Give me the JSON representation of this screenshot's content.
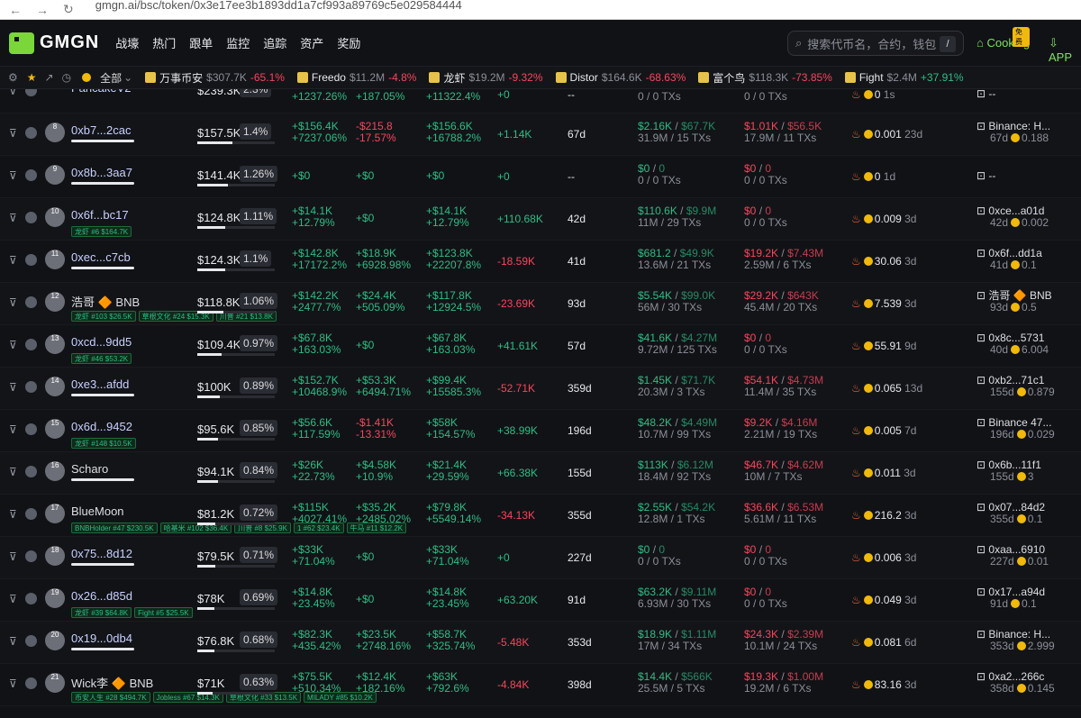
{
  "browser": {
    "url": "gmgn.ai/bsc/token/0x3e17ee3b1893dd1a7cf993a89769c5e029584444"
  },
  "header": {
    "logo": "GMGN",
    "menu": [
      "战壕",
      "热门",
      "跟单",
      "监控",
      "追踪",
      "资产",
      "奖励"
    ],
    "search_placeholder": "搜索代币名，合约，钱包",
    "search_key": "/",
    "cooking": "Cooking",
    "cooking_badge": "免费",
    "app": "APP"
  },
  "ticker": {
    "filter_label": "全部",
    "items": [
      {
        "name": "万事币安",
        "mc": "$307.7K",
        "change": "-65.1%",
        "dir": "neg"
      },
      {
        "name": "Freedo",
        "mc": "$11.2M",
        "change": "-4.8%",
        "dir": "neg"
      },
      {
        "name": "龙虾",
        "mc": "$19.2M",
        "change": "-9.32%",
        "dir": "neg"
      },
      {
        "name": "Distor",
        "mc": "$164.6K",
        "change": "-68.63%",
        "dir": "neg"
      },
      {
        "name": "富个鸟",
        "mc": "$118.3K",
        "change": "-73.85%",
        "dir": "neg"
      },
      {
        "name": "Fight",
        "mc": "$2.4M",
        "change": "+37.91%",
        "dir": "pos"
      }
    ]
  },
  "partial_row": {
    "addr": "PancakeV2",
    "bal": "$239.3K",
    "pct": "2.3%",
    "v1b": "+1237.26%",
    "v2b": "+187.05%",
    "v3b": "+11322.4%",
    "v4": "+0",
    "age": "--",
    "buyb": "0 / 0 TXs",
    "sellb": "0 / 0 TXs",
    "hold": "0",
    "hold_age": "1s",
    "src": "--"
  },
  "rows": [
    {
      "rank": "8",
      "addr": "0xb7...2cac",
      "bal": "$157.5K",
      "pct": "1.4%",
      "fill": 0.45,
      "v1a": "+$156.4K",
      "v1b": "+7237.06%",
      "v1c": "pos",
      "v2a": "-$215.8",
      "v2b": "-17.57%",
      "v2c": "neg",
      "v3a": "+$156.6K",
      "v3b": "+16788.2%",
      "v3c": "pos",
      "v4": "+1.14K",
      "v4c": "pos",
      "age": "67d",
      "buya": "$2.16K",
      "buyb": "$67.7K",
      "buyc": "31.9M / 15 TXs",
      "sella": "$1.01K",
      "sellb": "$56.5K",
      "sellc": "17.9M / 11 TXs",
      "hold": "0.001",
      "hold_age": "23d",
      "srca": "Binance: H...",
      "srcb": "67d",
      "srcc": "0.188",
      "badges": []
    },
    {
      "rank": "9",
      "addr": "0x8b...3aa7",
      "bal": "$141.4K",
      "pct": "1.26%",
      "fill": 0.4,
      "v1a": "+$0",
      "v1b": "",
      "v1c": "pos",
      "v2a": "+$0",
      "v2b": "",
      "v2c": "pos",
      "v3a": "+$0",
      "v3b": "",
      "v3c": "pos",
      "v4": "+0",
      "v4c": "pos",
      "age": "--",
      "buya": "$0",
      "buyb": "0",
      "buyc": "0 / 0 TXs",
      "sella": "$0",
      "sellb": "0",
      "sellc": "0 / 0 TXs",
      "hold": "0",
      "hold_age": "1d",
      "srca": "--",
      "srcb": "",
      "srcc": "",
      "badges": []
    },
    {
      "rank": "10",
      "addr": "0x6f...bc17",
      "bal": "$124.8K",
      "pct": "1.11%",
      "fill": 0.36,
      "v1a": "+$14.1K",
      "v1b": "+12.79%",
      "v1c": "pos",
      "v2a": "+$0",
      "v2b": "",
      "v2c": "pos",
      "v3a": "+$14.1K",
      "v3b": "+12.79%",
      "v3c": "pos",
      "v4": "+110.68K",
      "v4c": "pos",
      "age": "42d",
      "buya": "$110.6K",
      "buyb": "$9.9M",
      "buyc": "11M / 29 TXs",
      "sella": "$0",
      "sellb": "0",
      "sellc": "0 / 0 TXs",
      "hold": "0.009",
      "hold_age": "3d",
      "srca": "0xce...a01d",
      "srcb": "42d",
      "srcc": "0.002",
      "badges": [
        "龙虾 #6 $164.7K"
      ]
    },
    {
      "rank": "11",
      "addr": "0xec...c7cb",
      "bal": "$124.3K",
      "pct": "1.1%",
      "fill": 0.36,
      "v1a": "+$142.8K",
      "v1b": "+17172.2%",
      "v1c": "pos",
      "v2a": "+$18.9K",
      "v2b": "+6928.98%",
      "v2c": "pos",
      "v3a": "+$123.8K",
      "v3b": "+22207.8%",
      "v3c": "pos",
      "v4": "-18.59K",
      "v4c": "neg",
      "age": "41d",
      "buya": "$681.2",
      "buyb": "$49.9K",
      "buyc": "13.6M / 21 TXs",
      "sella": "$19.2K",
      "sellb": "$7.43M",
      "sellc": "2.59M / 6 TXs",
      "hold": "30.06",
      "hold_age": "3d",
      "srca": "0x6f...dd1a",
      "srcb": "41d",
      "srcc": "0.1",
      "badges": []
    },
    {
      "rank": "12",
      "addr": "浩哥 🔶 BNB",
      "bal": "$118.8K",
      "pct": "1.06%",
      "fill": 0.34,
      "v1a": "+$142.2K",
      "v1b": "+2477.7%",
      "v1c": "pos",
      "v2a": "+$24.4K",
      "v2b": "+505.09%",
      "v2c": "pos",
      "v3a": "+$117.8K",
      "v3b": "+12924.5%",
      "v3c": "pos",
      "v4": "-23.69K",
      "v4c": "neg",
      "age": "93d",
      "buya": "$5.54K",
      "buyb": "$99.0K",
      "buyc": "56M / 30 TXs",
      "sella": "$29.2K",
      "sellb": "$643K",
      "sellc": "45.4M / 20 TXs",
      "hold": "7.539",
      "hold_age": "3d",
      "srca": "浩哥 🔶 BNB",
      "srcb": "93d",
      "srcc": "0.5",
      "badges": [
        "龙虾 #103 $26.5K",
        "草根文化 #24 $15.3K",
        "川普 #21 $13.8K"
      ]
    },
    {
      "rank": "13",
      "addr": "0xcd...9dd5",
      "bal": "$109.4K",
      "pct": "0.97%",
      "fill": 0.31,
      "v1a": "+$67.8K",
      "v1b": "+163.03%",
      "v1c": "pos",
      "v2a": "+$0",
      "v2b": "",
      "v2c": "pos",
      "v3a": "+$67.8K",
      "v3b": "+163.03%",
      "v3c": "pos",
      "v4": "+41.61K",
      "v4c": "pos",
      "age": "57d",
      "buya": "$41.6K",
      "buyb": "$4.27M",
      "buyc": "9.72M / 125 TXs",
      "sella": "$0",
      "sellb": "0",
      "sellc": "0 / 0 TXs",
      "hold": "55.91",
      "hold_age": "9d",
      "srca": "0x8c...5731",
      "srcb": "40d",
      "srcc": "6.004",
      "badges": [
        "龙虾 #46 $53.2K"
      ]
    },
    {
      "rank": "14",
      "addr": "0xe3...afdd",
      "bal": "$100K",
      "pct": "0.89%",
      "fill": 0.29,
      "v1a": "+$152.7K",
      "v1b": "+10468.9%",
      "v1c": "pos",
      "v2a": "+$53.3K",
      "v2b": "+6494.71%",
      "v2c": "pos",
      "v3a": "+$99.4K",
      "v3b": "+15585.3%",
      "v3c": "pos",
      "v4": "-52.71K",
      "v4c": "neg",
      "age": "359d",
      "buya": "$1.45K",
      "buyb": "$71.7K",
      "buyc": "20.3M / 3 TXs",
      "sella": "$54.1K",
      "sellb": "$4.73M",
      "sellc": "11.4M / 35 TXs",
      "hold": "0.065",
      "hold_age": "13d",
      "srca": "0xb2...71c1",
      "srcb": "155d",
      "srcc": "0.879",
      "badges": []
    },
    {
      "rank": "15",
      "addr": "0x6d...9452",
      "bal": "$95.6K",
      "pct": "0.85%",
      "fill": 0.27,
      "v1a": "+$56.6K",
      "v1b": "+117.59%",
      "v1c": "pos",
      "v2a": "-$1.41K",
      "v2b": "-13.31%",
      "v2c": "neg",
      "v3a": "+$58K",
      "v3b": "+154.57%",
      "v3c": "pos",
      "v4": "+38.99K",
      "v4c": "pos",
      "age": "196d",
      "buya": "$48.2K",
      "buyb": "$4.49M",
      "buyc": "10.7M / 99 TXs",
      "sella": "$9.2K",
      "sellb": "$4.16M",
      "sellc": "2.21M / 19 TXs",
      "hold": "0.005",
      "hold_age": "7d",
      "srca": "Binance 47...",
      "srcb": "196d",
      "srcc": "0.029",
      "badges": [
        "龙虾 #148 $10.5K"
      ]
    },
    {
      "rank": "16",
      "addr": "Scharo",
      "bal": "$94.1K",
      "pct": "0.84%",
      "fill": 0.27,
      "v1a": "+$26K",
      "v1b": "+22.73%",
      "v1c": "pos",
      "v2a": "+$4.58K",
      "v2b": "+10.9%",
      "v2c": "pos",
      "v3a": "+$21.4K",
      "v3b": "+29.59%",
      "v3c": "pos",
      "v4": "+66.38K",
      "v4c": "pos",
      "age": "155d",
      "buya": "$113K",
      "buyb": "$6.12M",
      "buyc": "18.4M / 92 TXs",
      "sella": "$46.7K",
      "sellb": "$4.62M",
      "sellc": "10M / 7 TXs",
      "hold": "0.011",
      "hold_age": "3d",
      "srca": "0x6b...11f1",
      "srcb": "155d",
      "srcc": "3",
      "badges": []
    },
    {
      "rank": "17",
      "addr": "BlueMoon",
      "bal": "$81.2K",
      "pct": "0.72%",
      "fill": 0.23,
      "v1a": "+$115K",
      "v1b": "+4027.41%",
      "v1c": "pos",
      "v2a": "+$35.2K",
      "v2b": "+2485.02%",
      "v2c": "pos",
      "v3a": "+$79.8K",
      "v3b": "+5549.14%",
      "v3c": "pos",
      "v4": "-34.13K",
      "v4c": "neg",
      "age": "355d",
      "buya": "$2.55K",
      "buyb": "$54.2K",
      "buyc": "12.8M / 1 TXs",
      "sella": "$36.6K",
      "sellb": "$6.53M",
      "sellc": "5.61M / 11 TXs",
      "hold": "216.2",
      "hold_age": "3d",
      "srca": "0x07...84d2",
      "srcb": "355d",
      "srcc": "0.1",
      "badges": [
        "BNBHolder #47 $230.5K",
        "哈基米 #102 $36.4K",
        "川普 #8 $25.9K",
        "1 #62 $23.4K",
        "牛马 #11 $12.2K"
      ]
    },
    {
      "rank": "18",
      "addr": "0x75...8d12",
      "bal": "$79.5K",
      "pct": "0.71%",
      "fill": 0.23,
      "v1a": "+$33K",
      "v1b": "+71.04%",
      "v1c": "pos",
      "v2a": "+$0",
      "v2b": "",
      "v2c": "pos",
      "v3a": "+$33K",
      "v3b": "+71.04%",
      "v3c": "pos",
      "v4": "+0",
      "v4c": "pos",
      "age": "227d",
      "buya": "$0",
      "buyb": "0",
      "buyc": "0 / 0 TXs",
      "sella": "$0",
      "sellb": "0",
      "sellc": "0 / 0 TXs",
      "hold": "0.006",
      "hold_age": "3d",
      "srca": "0xaa...6910",
      "srcb": "227d",
      "srcc": "0.01",
      "badges": []
    },
    {
      "rank": "19",
      "addr": "0x26...d85d",
      "bal": "$78K",
      "pct": "0.69%",
      "fill": 0.22,
      "v1a": "+$14.8K",
      "v1b": "+23.45%",
      "v1c": "pos",
      "v2a": "+$0",
      "v2b": "",
      "v2c": "pos",
      "v3a": "+$14.8K",
      "v3b": "+23.45%",
      "v3c": "pos",
      "v4": "+63.20K",
      "v4c": "pos",
      "age": "91d",
      "buya": "$63.2K",
      "buyb": "$9.11M",
      "buyc": "6.93M / 30 TXs",
      "sella": "$0",
      "sellb": "0",
      "sellc": "0 / 0 TXs",
      "hold": "0.049",
      "hold_age": "3d",
      "srca": "0x17...a94d",
      "srcb": "91d",
      "srcc": "0.1",
      "badges": [
        "龙虾 #39 $64.8K",
        "Fight #5 $25.5K"
      ]
    },
    {
      "rank": "20",
      "addr": "0x19...0db4",
      "bal": "$76.8K",
      "pct": "0.68%",
      "fill": 0.22,
      "v1a": "+$82.3K",
      "v1b": "+435.42%",
      "v1c": "pos",
      "v2a": "+$23.5K",
      "v2b": "+2748.16%",
      "v2c": "pos",
      "v3a": "+$58.7K",
      "v3b": "+325.74%",
      "v3c": "pos",
      "v4": "-5.48K",
      "v4c": "neg",
      "age": "353d",
      "buya": "$18.9K",
      "buyb": "$1.11M",
      "buyc": "17M / 34 TXs",
      "sella": "$24.3K",
      "sellb": "$2.39M",
      "sellc": "10.1M / 24 TXs",
      "hold": "0.081",
      "hold_age": "6d",
      "srca": "Binance: H...",
      "srcb": "353d",
      "srcc": "2.999",
      "badges": []
    },
    {
      "rank": "21",
      "addr": "Wick李 🔶 BNB",
      "bal": "$71K",
      "pct": "0.63%",
      "fill": 0.2,
      "v1a": "+$75.5K",
      "v1b": "+510.34%",
      "v1c": "pos",
      "v2a": "+$12.4K",
      "v2b": "+182.16%",
      "v2c": "pos",
      "v3a": "+$63K",
      "v3b": "+792.6%",
      "v3c": "pos",
      "v4": "-4.84K",
      "v4c": "neg",
      "age": "398d",
      "buya": "$14.4K",
      "buyb": "$566K",
      "buyc": "25.5M / 5 TXs",
      "sella": "$19.3K",
      "sellb": "$1.00M",
      "sellc": "19.2M / 6 TXs",
      "hold": "83.16",
      "hold_age": "3d",
      "srca": "0xa2...266c",
      "srcb": "358d",
      "srcc": "0.145",
      "badges": [
        "币安人生 #28 $494.7K",
        "Jobless #67 $14.3K",
        "草根文化 #33 $13.5K",
        "MILADY #85 $10.2K"
      ]
    }
  ]
}
